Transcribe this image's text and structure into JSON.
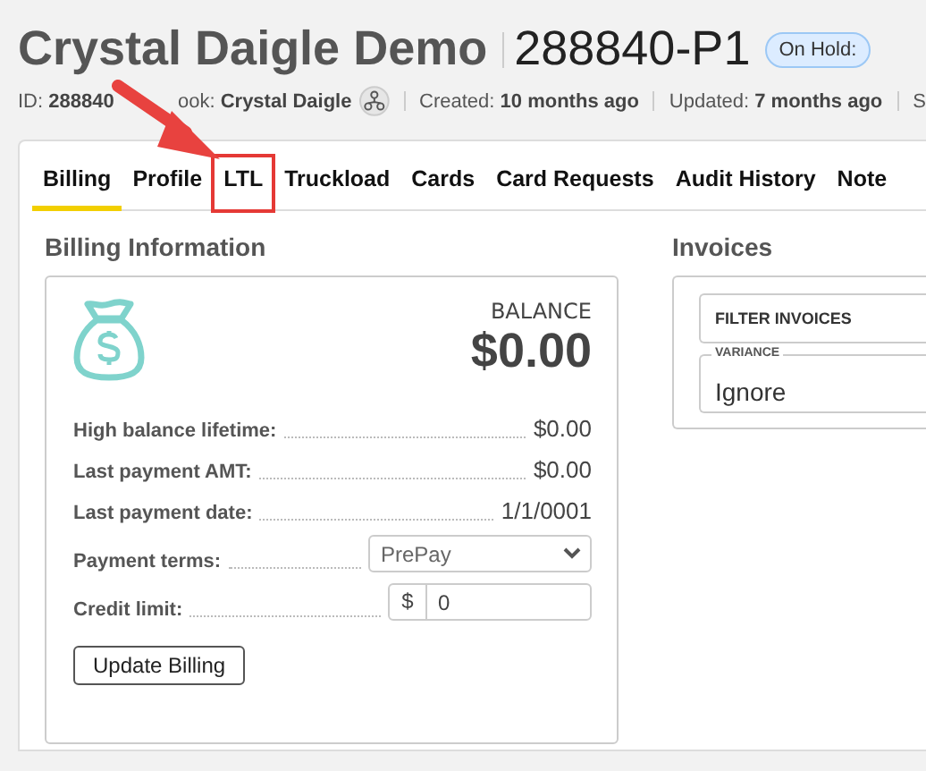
{
  "header": {
    "title": "Crystal Daigle Demo",
    "number": "288840-P1",
    "badge": "On Hold:"
  },
  "meta": [
    {
      "label": "ID:",
      "value": "288840",
      "kind": "text"
    },
    {
      "label": "ook:",
      "value": "Crystal Daigle",
      "kind": "book"
    },
    {
      "label": "Created:",
      "value": "10 months ago",
      "kind": "text"
    },
    {
      "label": "Updated:",
      "value": "7 months ago",
      "kind": "text"
    },
    {
      "label": "S",
      "kind": "cut"
    }
  ],
  "tabs": [
    {
      "label": "Billing",
      "selected": true,
      "highlighted": false
    },
    {
      "label": "Profile",
      "selected": false,
      "highlighted": false
    },
    {
      "label": "LTL",
      "selected": false,
      "highlighted": true
    },
    {
      "label": "Truckload",
      "selected": false,
      "highlighted": false
    },
    {
      "label": "Cards",
      "selected": false,
      "highlighted": false
    },
    {
      "label": "Card Requests",
      "selected": false,
      "highlighted": false
    },
    {
      "label": "Audit History",
      "selected": false,
      "highlighted": false
    },
    {
      "label": "Note",
      "selected": false,
      "highlighted": false
    }
  ],
  "billing": {
    "heading": "Billing Information",
    "balance_label": "BALANCE",
    "balance": "$0.00",
    "rows": [
      {
        "label": "High balance lifetime:",
        "value": "$0.00",
        "kind": "text"
      },
      {
        "label": "Last payment AMT:",
        "value": "$0.00",
        "kind": "text"
      },
      {
        "label": "Last payment date:",
        "value": "1/1/0001",
        "kind": "text"
      },
      {
        "label": "Payment terms:",
        "value": "PrePay",
        "kind": "select"
      },
      {
        "label": "Credit limit:",
        "value": "0",
        "prefix": "$",
        "kind": "money"
      }
    ],
    "button": "Update Billing"
  },
  "invoices": {
    "heading": "Invoices",
    "filter": "FILTER INVOICES",
    "variance_label": "VARIANCE",
    "variance": "Ignore"
  }
}
